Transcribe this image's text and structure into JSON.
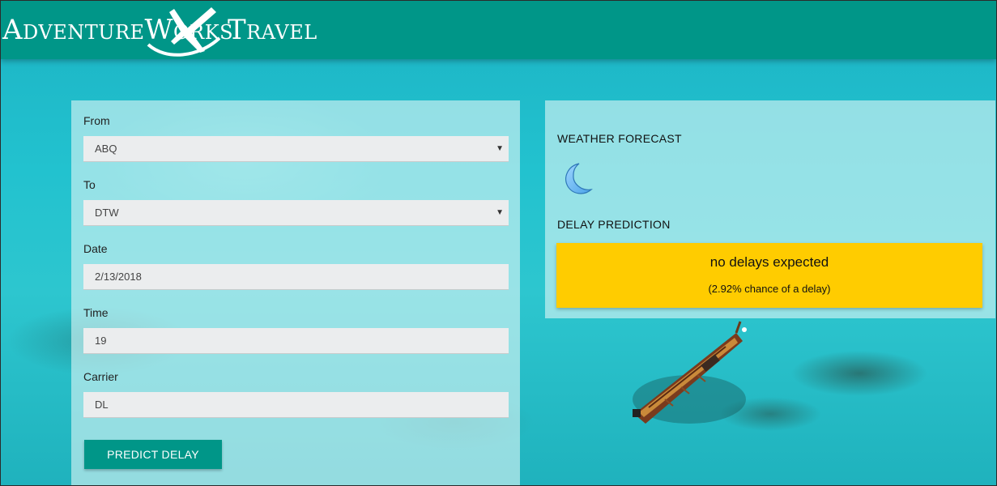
{
  "header": {
    "logo_left": "AdventureWorks",
    "logo_right": "Travel",
    "logo_icon": "airplane-swoosh-icon",
    "background_color": "#009688"
  },
  "form": {
    "from_label": "From",
    "from_value": "ABQ",
    "to_label": "To",
    "to_value": "DTW",
    "date_label": "Date",
    "date_value": "2/13/2018",
    "time_label": "Time",
    "time_value": "19",
    "carrier_label": "Carrier",
    "carrier_value": "DL",
    "predict_button": "PREDICT DELAY",
    "dropdown_icon": "chevron-down-icon"
  },
  "results": {
    "weather_title": "WEATHER FORECAST",
    "weather_icon": "crescent-moon-icon",
    "delay_title": "DELAY PREDICTION",
    "delay_main": "no delays expected",
    "delay_sub": "(2.92% chance of a delay)",
    "delay_color": "#ffcc00"
  },
  "colors": {
    "accent": "#009688",
    "field_background": "#ebedee"
  }
}
